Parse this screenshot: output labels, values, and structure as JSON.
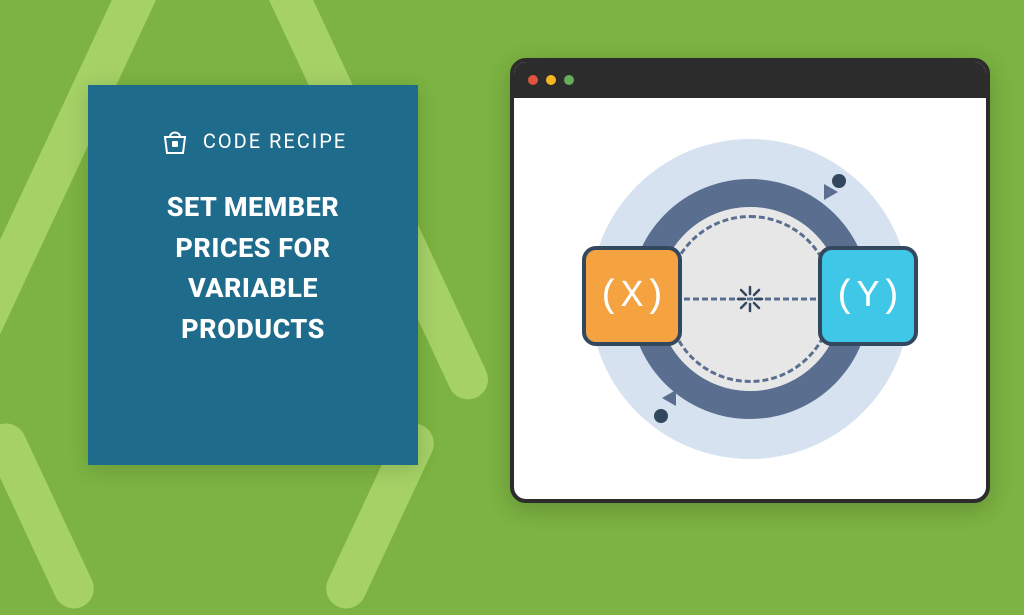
{
  "brand": "CODE RECIPE",
  "headline": "SET MEMBER PRICES FOR VARIABLE PRODUCTS",
  "colors": {
    "bg": "#7CB342",
    "card": "#1F6B8C",
    "box_x": "#F4A340",
    "box_y": "#3FC7E8",
    "ring": "#5A6F8F"
  },
  "diagram": {
    "left_label": "(X)",
    "right_label": "(Y)"
  },
  "window": {
    "dots": [
      "red",
      "yellow",
      "green"
    ]
  }
}
